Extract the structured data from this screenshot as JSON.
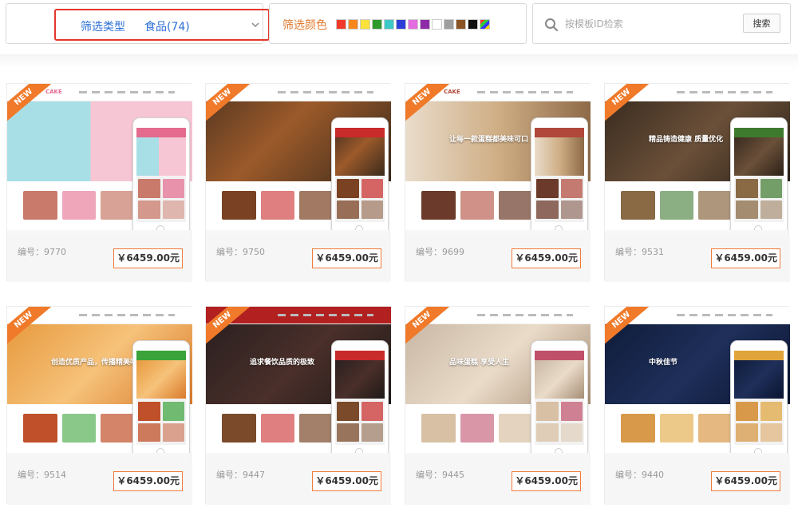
{
  "filter": {
    "type_label": "筛选类型",
    "type_value": "食品(74)",
    "color_label": "筛选颜色",
    "colors": [
      "#f03a2a",
      "#f7861d",
      "#f9e23a",
      "#2c9a2c",
      "#3dc8c8",
      "#2b3fd6",
      "#e36ce0",
      "#8e2aa8",
      "#ffffff",
      "#9e9e9e",
      "#8a5424",
      "#111111"
    ],
    "search_placeholder": "按模板ID检索",
    "search_button": "搜索"
  },
  "badge_text": "NEW",
  "cards": [
    {
      "code": "编号：9770",
      "price": "￥6459.00元",
      "logo": "CAKE",
      "theme": {
        "nav": "#ffffff",
        "hero": "linear-gradient(90deg,#a8dfe6 0%,#a8dfe6 45%,#f7c6d4 45%,#f7c6d4 100%)",
        "accent": "#e46a8e",
        "tile": "#c97a6a"
      },
      "hero_text": ""
    },
    {
      "code": "编号：9750",
      "price": "￥6459.00元",
      "logo": "",
      "theme": {
        "nav": "#ffffff",
        "hero": "linear-gradient(135deg,#5b3a22,#9c5a2a 40%,#3a2a1c)",
        "accent": "#c92a2a",
        "tile": "#7a4222"
      },
      "hero_text": ""
    },
    {
      "code": "编号：9699",
      "price": "￥6459.00元",
      "logo": "CAKE",
      "theme": {
        "nav": "#ffffff",
        "hero": "linear-gradient(90deg,#e9dccb,#cfae85 50%,#8e6a48)",
        "accent": "#b0473a",
        "tile": "#6c3a2a"
      },
      "hero_text": "让每一款蛋糕都美味可口"
    },
    {
      "code": "编号：9531",
      "price": "￥6459.00元",
      "logo": "",
      "theme": {
        "nav": "#ffffff",
        "hero": "linear-gradient(135deg,#3a2c20,#6b5039 50%,#2b2118)",
        "accent": "#3e7a2e",
        "tile": "#8a6a44"
      },
      "hero_text": "精品铸造健康 质量优化"
    },
    {
      "code": "编号：9514",
      "price": "￥6459.00元",
      "logo": "",
      "theme": {
        "nav": "#ffffff",
        "hero": "linear-gradient(135deg,#e79a3e,#f6c27a 50%,#d97a2a)",
        "accent": "#3aa33a",
        "tile": "#c0502a"
      },
      "hero_text": "创造优质产品，传播精美味"
    },
    {
      "code": "编号：9447",
      "price": "￥6459.00元",
      "logo": "",
      "theme": {
        "nav": "#b32020",
        "hero": "linear-gradient(135deg,#2b2020,#4a2f2a 50%,#1f1a18)",
        "accent": "#c92a2a",
        "tile": "#7a4a2a"
      },
      "hero_text": "追求餐饮品质的极致"
    },
    {
      "code": "编号：9445",
      "price": "￥6459.00元",
      "logo": "",
      "theme": {
        "nav": "#ffffff",
        "hero": "linear-gradient(135deg,#c9b7a5,#eadbc9 50%,#a68e74)",
        "accent": "#c0506a",
        "tile": "#d8c0a4"
      },
      "hero_text": "品味蛋糕 享受人生"
    },
    {
      "code": "编号：9440",
      "price": "￥6459.00元",
      "logo": "",
      "theme": {
        "nav": "#ffffff",
        "hero": "linear-gradient(135deg,#0f1c3a,#1f2f5a 50%,#0a1430)",
        "accent": "#e0a43a",
        "tile": "#d89a4a"
      },
      "hero_text": "中秋佳节"
    }
  ]
}
